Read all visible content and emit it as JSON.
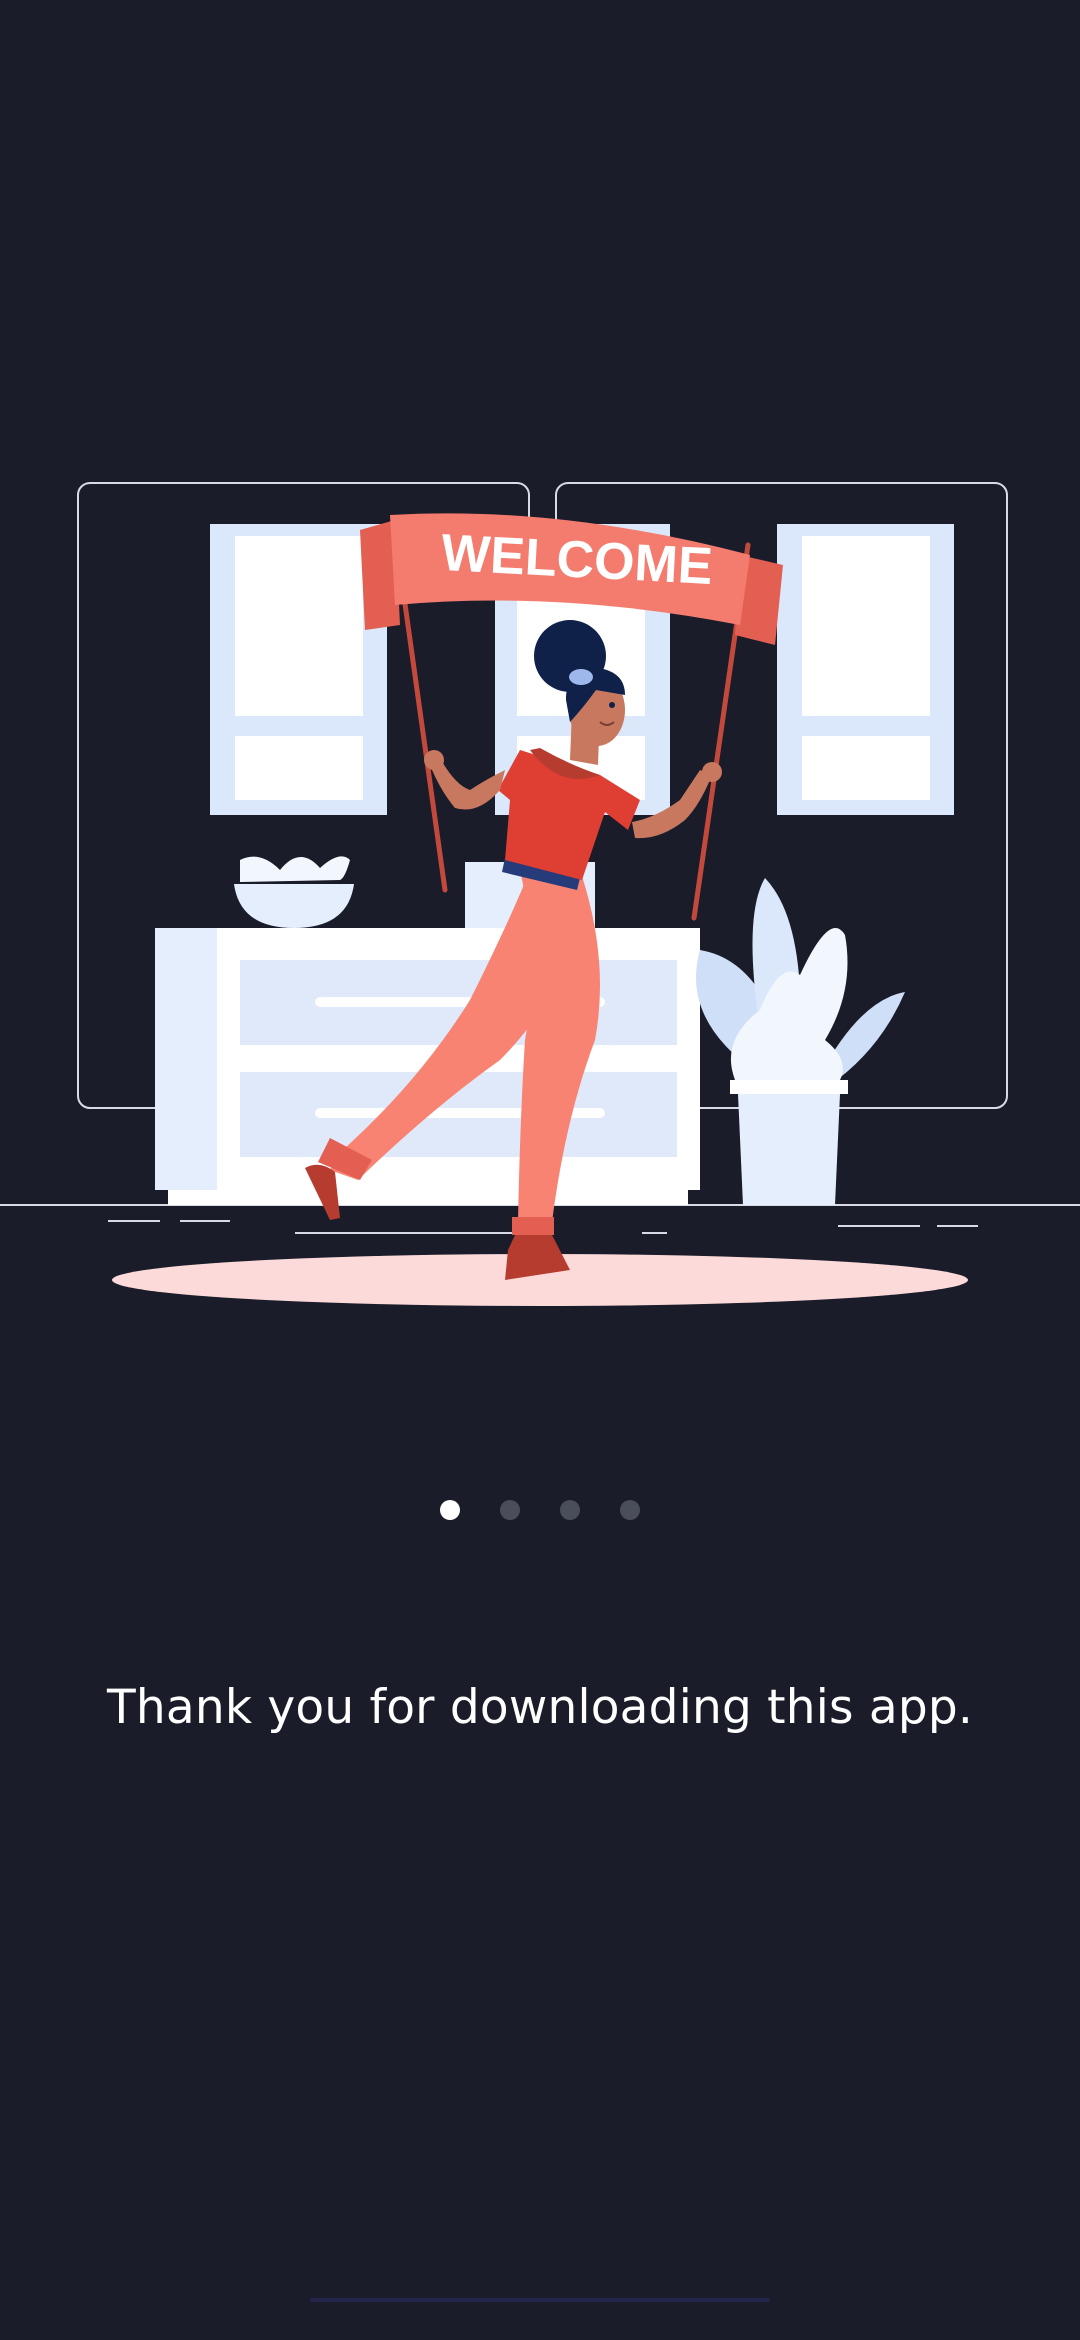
{
  "illustration": {
    "banner_text": "WELCOME",
    "description_icon": "welcome-illustration",
    "colors": {
      "background": "#1a1c29",
      "banner": "#f47c6e",
      "banner_dark": "#e35f51",
      "shirt": "#df3e33",
      "pants": "#f98373",
      "skin": "#c8785e",
      "hair": "#0f2149",
      "furniture": "#e4eefc",
      "floor_shadow": "#fddada"
    }
  },
  "pager": {
    "total": 4,
    "active_index": 0
  },
  "onboarding": {
    "message": "Thank you for downloading this app."
  }
}
